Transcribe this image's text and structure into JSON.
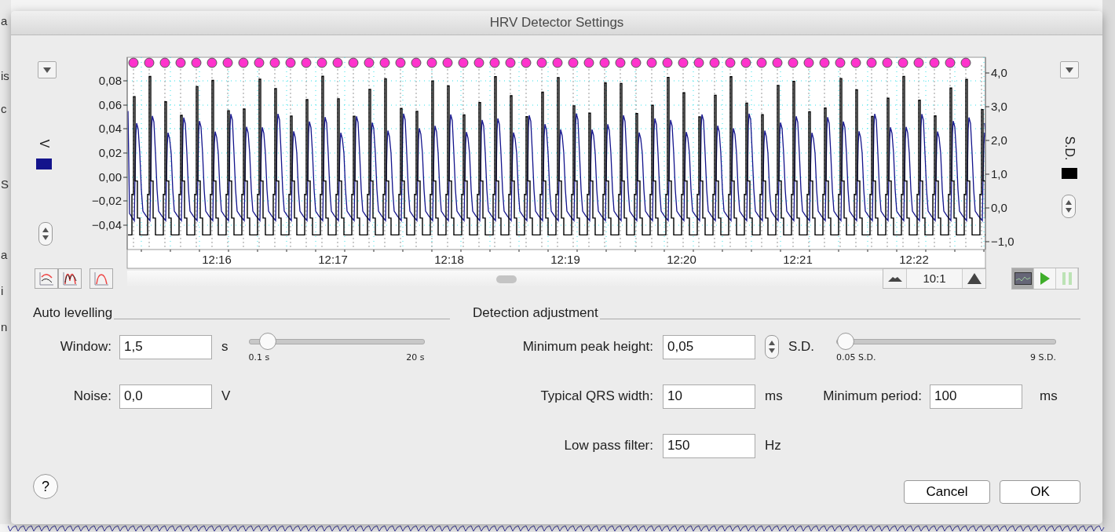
{
  "background_window": {
    "fragments": [
      "a",
      "is",
      "c",
      "S",
      "a",
      "i",
      "n"
    ]
  },
  "window": {
    "title": "HRV Detector Settings"
  },
  "chart": {
    "series": [
      {
        "unit": "V",
        "color": "#14148c"
      },
      {
        "unit": "S.D.",
        "color": "#000000"
      }
    ],
    "y_left_ticks": [
      "0,08",
      "0,06",
      "0,04",
      "0,02",
      "0,00",
      "−0,02",
      "−0,04"
    ],
    "y_right_ticks": [
      "4,0",
      "3,0",
      "2,0",
      "1,0",
      "0,0",
      "−1,0"
    ],
    "x_ticks": [
      "12:16",
      "12:17",
      "12:18",
      "12:19",
      "12:20",
      "12:21",
      "12:22"
    ],
    "zoom": "10:1"
  },
  "view_buttons": [
    {
      "kind": "chart",
      "selected": true,
      "disabled": false
    },
    {
      "kind": "play",
      "selected": false,
      "disabled": false
    },
    {
      "kind": "pause",
      "selected": false,
      "disabled": true
    }
  ],
  "auto_levelling": {
    "title": "Auto levelling",
    "window": {
      "label": "Window:",
      "value": "1,5",
      "unit": "s",
      "slider": {
        "level": 0.06,
        "min_label": "0.1 s",
        "max_label": "20 s"
      }
    },
    "noise": {
      "label": "Noise:",
      "value": "0,0",
      "unit": "V"
    }
  },
  "detection": {
    "title": "Detection adjustment",
    "min_peak": {
      "label": "Minimum peak height:",
      "value": "0,05",
      "unit": "S.D.",
      "slider": {
        "level": 0.0,
        "min_label": "0.05 S.D.",
        "max_label": "9 S.D."
      }
    },
    "qrs_width": {
      "label": "Typical QRS width:",
      "value": "10",
      "unit": "ms"
    },
    "min_period": {
      "label": "Minimum period:",
      "value": "100",
      "unit": "ms"
    },
    "low_pass": {
      "label": "Low pass filter:",
      "value": "150",
      "unit": "Hz"
    }
  },
  "help": "?",
  "buttons": [
    {
      "label": "Cancel"
    },
    {
      "label": "OK"
    }
  ]
}
